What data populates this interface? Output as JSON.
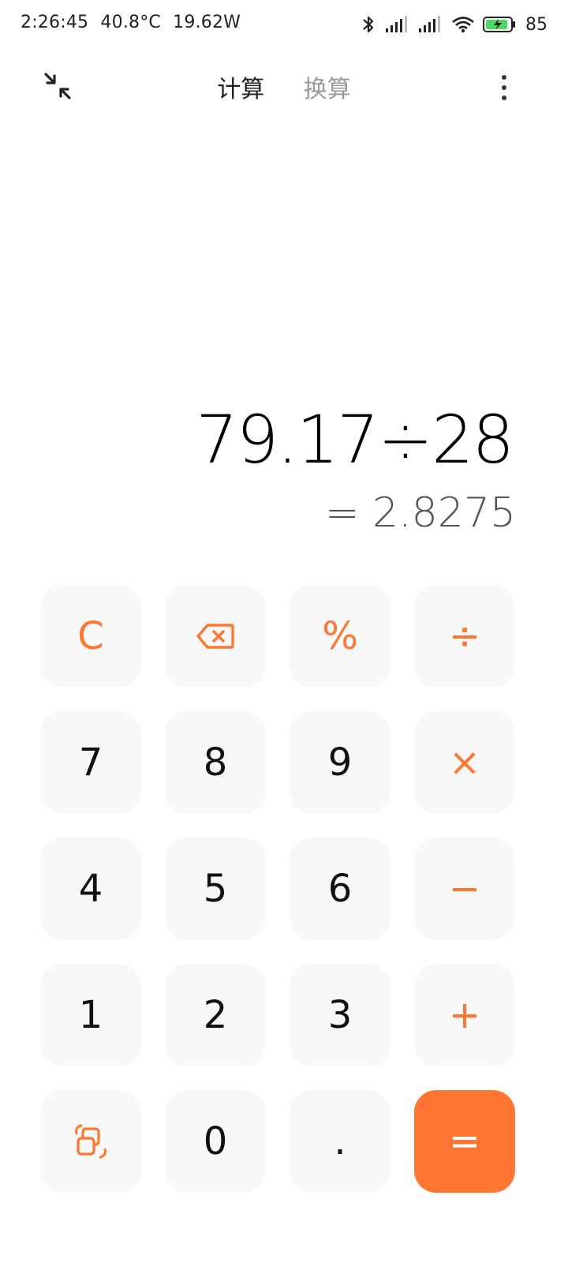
{
  "status_bar": {
    "time": "2:26:45",
    "temperature": "40.8°C",
    "power": "19.62W",
    "battery_level": "85",
    "icons": [
      "bluetooth-icon",
      "signal-icon",
      "signal-icon",
      "wifi-icon",
      "battery-charging-icon"
    ]
  },
  "header": {
    "tabs": [
      {
        "label": "计算",
        "active": true
      },
      {
        "label": "换算",
        "active": false
      }
    ],
    "left_icon": "collapse-icon",
    "right_icon": "more-vertical-icon"
  },
  "display": {
    "expression": "79.17÷28",
    "result": "= 2.8275"
  },
  "keypad": {
    "row1": [
      "C",
      "backspace",
      "%",
      "÷"
    ],
    "row2": [
      "7",
      "8",
      "9",
      "×"
    ],
    "row3": [
      "4",
      "5",
      "6",
      "−"
    ],
    "row4": [
      "1",
      "2",
      "3",
      "+"
    ],
    "row5": [
      "switch-mode",
      "0",
      ".",
      "="
    ],
    "labels": {
      "clear": "C",
      "percent": "%",
      "divide": "÷",
      "seven": "7",
      "eight": "8",
      "nine": "9",
      "multiply": "×",
      "four": "4",
      "five": "5",
      "six": "6",
      "minus": "−",
      "one": "1",
      "two": "2",
      "three": "3",
      "plus": "+",
      "zero": "0",
      "dot": ".",
      "equals": "="
    }
  },
  "colors": {
    "accent": "#ff7532",
    "key_background": "#f8f8f8",
    "text_primary": "#000000",
    "text_result": "#555555"
  }
}
